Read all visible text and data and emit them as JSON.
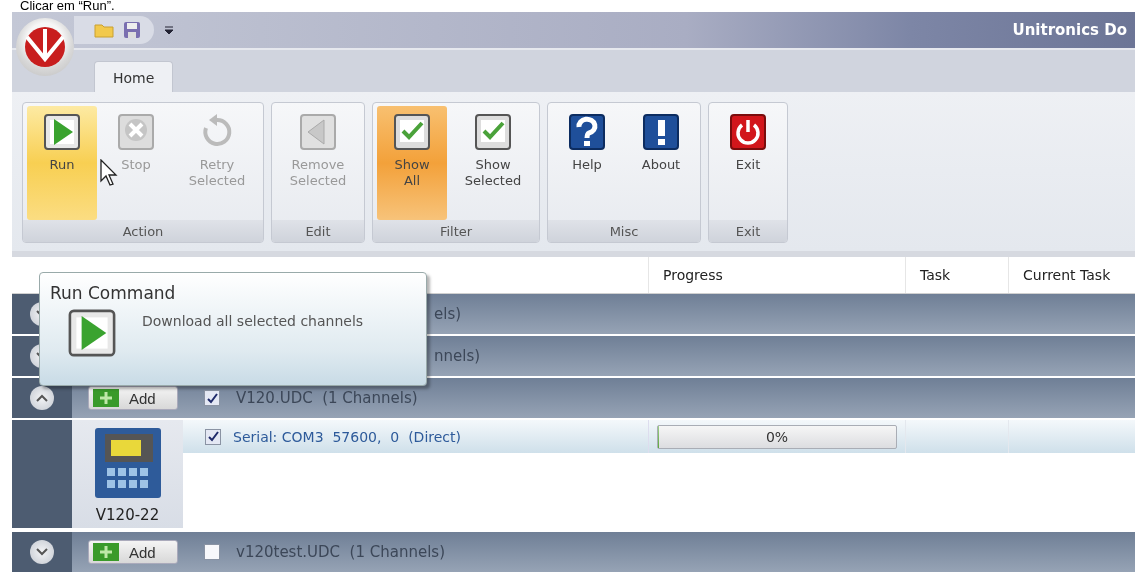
{
  "caption": "Clicar em “Run”.",
  "window": {
    "title": "Unitronics Do"
  },
  "tabs": [
    {
      "label": "Home",
      "selected": true
    }
  ],
  "ribbon": [
    {
      "label": "Action",
      "buttons": [
        {
          "label": "Run",
          "kind": "run",
          "selected": true,
          "disabled": false
        },
        {
          "label": "Stop",
          "kind": "stop",
          "selected": false,
          "disabled": true
        },
        {
          "label": "Retry Selected",
          "kind": "retry",
          "selected": false,
          "disabled": true
        }
      ]
    },
    {
      "label": "Edit",
      "buttons": [
        {
          "label": "Remove Selected",
          "kind": "remove",
          "selected": false,
          "disabled": true
        }
      ]
    },
    {
      "label": "Filter",
      "buttons": [
        {
          "label": "Show All",
          "kind": "show_all",
          "selected": true,
          "disabled": false
        },
        {
          "label": "Show Selected",
          "kind": "show_selected",
          "selected": false,
          "disabled": false
        }
      ]
    },
    {
      "label": "Misc",
      "buttons": [
        {
          "label": "Help",
          "kind": "help",
          "selected": false,
          "disabled": false
        },
        {
          "label": "About",
          "kind": "about",
          "selected": false,
          "disabled": false
        }
      ]
    },
    {
      "label": "Exit",
      "buttons": [
        {
          "label": "Exit",
          "kind": "exit",
          "selected": false,
          "disabled": false
        }
      ]
    }
  ],
  "tooltip": {
    "title": "Run Command",
    "text": "Download all selected channels"
  },
  "table": {
    "columns": [
      "Progress",
      "Task",
      "Current Task"
    ],
    "groups": [
      {
        "label": "els)",
        "expanded": false
      },
      {
        "label": "nnels)",
        "expanded": false
      },
      {
        "label": "V120.UDC  (1 Channels)",
        "expanded": true,
        "add": "Add",
        "checked": true,
        "device": "V120-22",
        "channels": [
          {
            "label": "Serial: COM3  57600,  0  (Direct)",
            "checked": true,
            "progress": "0%",
            "level": 0
          }
        ]
      },
      {
        "label": "v120test.UDC  (1 Channels)",
        "expanded": false,
        "add": "Add",
        "checked": false
      }
    ]
  }
}
